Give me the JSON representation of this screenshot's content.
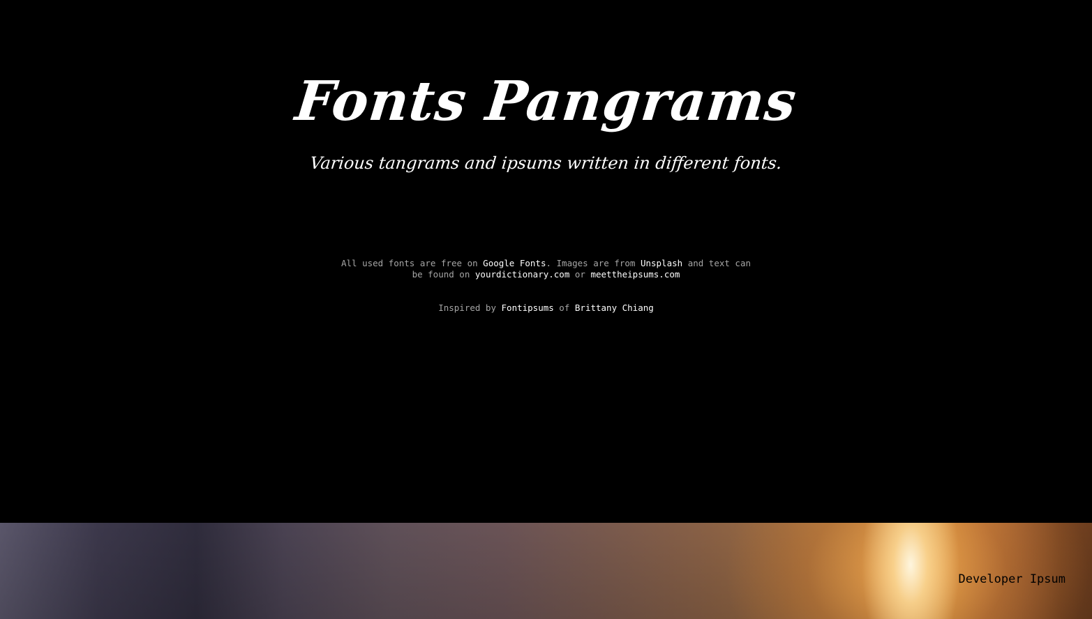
{
  "header": {
    "title": "Fonts Pangrams",
    "subtitle": "Various tangrams and ipsums written in different fonts."
  },
  "credits": {
    "text_1": "All used fonts are free on ",
    "link_google_fonts": "Google Fonts",
    "text_2": ". Images are from ",
    "link_unsplash": "Unsplash",
    "text_3": " and text can be found on ",
    "link_yourdictionary": "yourdictionary.com",
    "text_4": " or ",
    "link_meettheipsums": "meettheipsums.com"
  },
  "inspired": {
    "text_1": "Inspired by ",
    "link_fontipsums": "Fontipsums",
    "text_2": " of ",
    "link_author": "Brittany Chiang"
  },
  "cards": [
    {
      "label": "Developer Ipsum"
    }
  ]
}
